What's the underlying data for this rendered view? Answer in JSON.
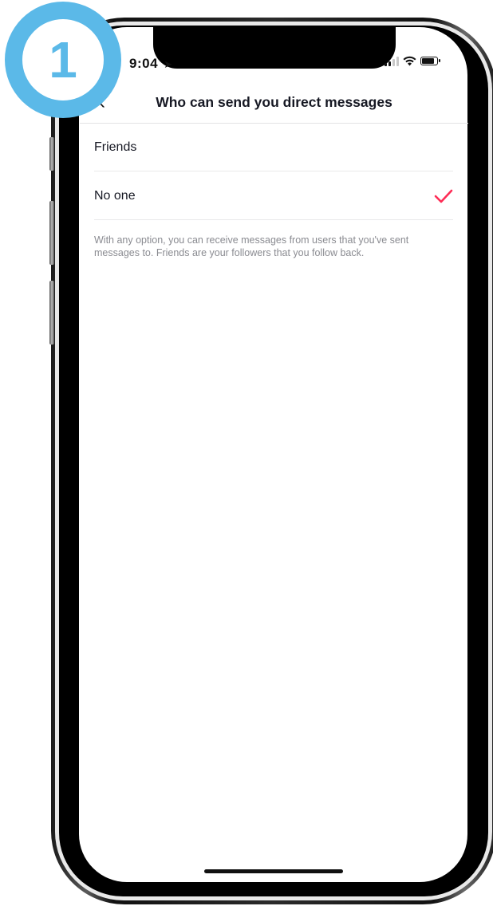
{
  "status_bar": {
    "time": "9:04",
    "location_icon": "location-arrow-icon",
    "signal_icon": "cellular-signal-icon",
    "wifi_icon": "wifi-icon",
    "battery_icon": "battery-icon"
  },
  "header": {
    "back_icon": "chevron-left-icon",
    "title": "Who can send you direct messages"
  },
  "options": [
    {
      "label": "Friends",
      "selected": false
    },
    {
      "label": "No one",
      "selected": true
    }
  ],
  "info_text": "With any option, you can receive messages from users that you've sent messages to. Friends are your followers that you follow back.",
  "step_badge": {
    "number": "1"
  },
  "colors": {
    "accent_check": "#fe2c55",
    "badge_blue": "#5bb9e8",
    "text_primary": "#161823",
    "text_secondary": "#8a8b91"
  }
}
